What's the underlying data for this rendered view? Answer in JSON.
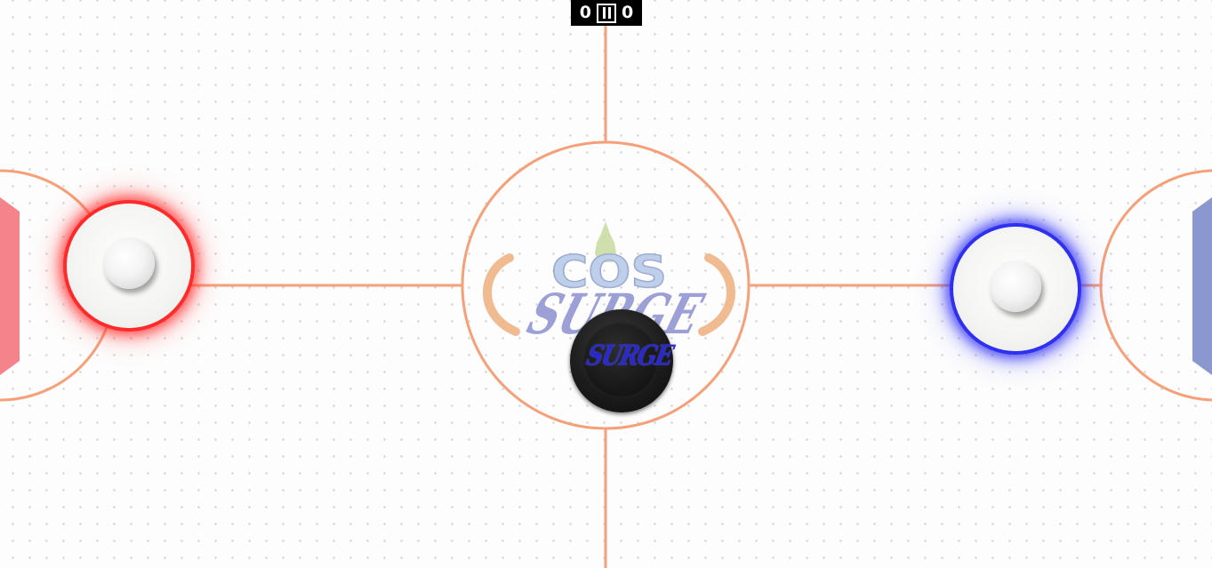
{
  "game": {
    "score": {
      "left": "0",
      "right": "0"
    },
    "pause_icon": "pause-icon",
    "logo": {
      "line1": "COS",
      "line2": "SURGE"
    },
    "puck": {
      "label": "SURGE"
    },
    "colors": {
      "table": "#fdfdfd",
      "dots": "#d2d2d2",
      "markings": "#f5a078",
      "left_player": "#ff2a2a",
      "right_player": "#3030f0",
      "left_goal": "#f4838b",
      "right_goal": "#8a98cf",
      "puck": "#141414",
      "scoreboard": "#000000"
    }
  }
}
